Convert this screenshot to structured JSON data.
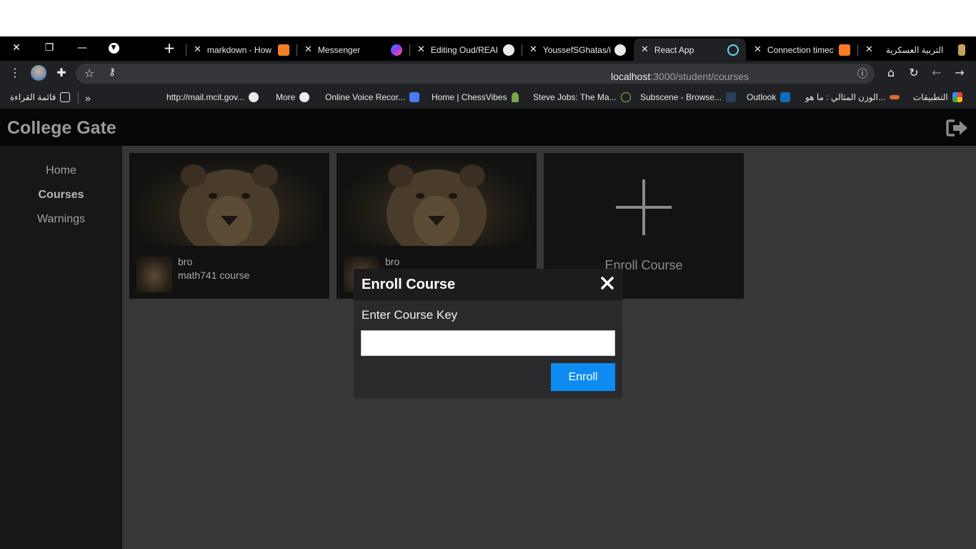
{
  "browser": {
    "tabs": [
      {
        "title": "markdown - How",
        "active": false
      },
      {
        "title": "Messenger",
        "active": false
      },
      {
        "title": "Editing Oud/REAI",
        "active": false
      },
      {
        "title": "YoussefSGhatas/i",
        "active": false
      },
      {
        "title": "React App",
        "active": true
      },
      {
        "title": "Connection timec",
        "active": false
      },
      {
        "title": "التربية العسكرية",
        "active": false
      }
    ],
    "url_host": "localhost",
    "url_rest": ":3000/student/courses",
    "bookmarks": [
      {
        "label": "قائمة القراءة",
        "icon": "reading-list-icon"
      },
      {
        "label": "http://mail.mcit.gov...",
        "icon": "globe-icon"
      },
      {
        "label": "More",
        "icon": "globe-icon"
      },
      {
        "label": "Online Voice Recor...",
        "icon": "mic-icon"
      },
      {
        "label": "Home | ChessVibes",
        "icon": "chess-icon"
      },
      {
        "label": "Steve Jobs: The Ma...",
        "icon": "site-icon"
      },
      {
        "label": "Subscene - Browse...",
        "icon": "subscene-icon"
      },
      {
        "label": "Outlook",
        "icon": "outlook-icon"
      },
      {
        "label": "الوزن المثالي : ما هو...",
        "icon": "site-icon"
      },
      {
        "label": "التطبيقات",
        "icon": "apps-grid-icon"
      }
    ],
    "bookmarks_overflow": "»"
  },
  "app": {
    "brand": "College Gate",
    "nav": [
      {
        "label": "Home",
        "active": false
      },
      {
        "label": "Courses",
        "active": true
      },
      {
        "label": "Warnings",
        "active": false
      }
    ],
    "courses": [
      {
        "instructor": "bro",
        "name": "math741 course"
      },
      {
        "instructor": "bro",
        "name": ""
      }
    ],
    "enroll_card_label": "Enroll Course"
  },
  "modal": {
    "title": "Enroll Course",
    "label": "Enter Course Key",
    "input_value": "",
    "input_placeholder": "",
    "button": "Enroll"
  },
  "colors": {
    "accent": "#0d8bf2",
    "app_bg": "#373737",
    "sidebar_bg": "#171717"
  }
}
